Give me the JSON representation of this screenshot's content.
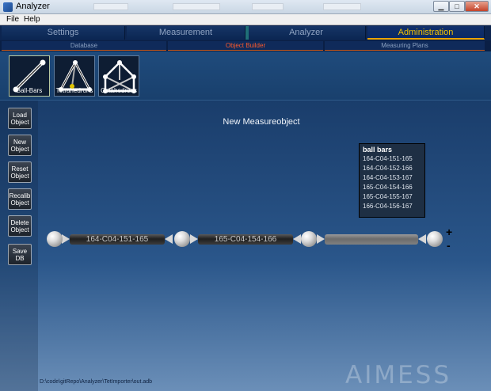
{
  "window": {
    "title": "Analyzer"
  },
  "menu": {
    "items": [
      "File",
      "Help"
    ]
  },
  "tabs": [
    {
      "label": "Settings"
    },
    {
      "label": "Measurement"
    },
    {
      "label": "Analyzer"
    },
    {
      "label": "Administration"
    }
  ],
  "subtabs": [
    {
      "label": "Database"
    },
    {
      "label": "Object Builder"
    },
    {
      "label": "Measuring Plans"
    }
  ],
  "templates": [
    {
      "label": "Ball-Bars",
      "icon": "ball-bar-icon"
    },
    {
      "label": "Tetrahedrons",
      "icon": "tetrahedron-icon"
    },
    {
      "label": "Octahedrons",
      "icon": "octahedron-icon"
    }
  ],
  "sidebar": {
    "buttons": [
      {
        "label": "Load Object"
      },
      {
        "label": "New Object"
      },
      {
        "label": "Reset Object"
      },
      {
        "label": "Recalib Object"
      },
      {
        "label": "Delete Object"
      },
      {
        "label": "Save DB"
      }
    ]
  },
  "canvas": {
    "title": "New Measureobject",
    "ballbars": [
      "164-C04-151-165",
      "165-C04-154-166",
      ""
    ],
    "zoom_in": "+",
    "zoom_out": "-"
  },
  "popup": {
    "title": "ball bars",
    "items": [
      "164-C04-151-165",
      "164-C04-152-166",
      "164-C04-153-167",
      "165-C04-154-166",
      "165-C04-155-167",
      "166-C04-156-167"
    ]
  },
  "status": {
    "path": "D:\\code\\gitRepo\\Analyzer\\TetImporter\\out.adb"
  },
  "brand": {
    "text": "AIMESS"
  },
  "colors": {
    "active_tab": "#f2c200",
    "active_subtab": "#ff5a2a",
    "background": "#1b3d6b"
  }
}
